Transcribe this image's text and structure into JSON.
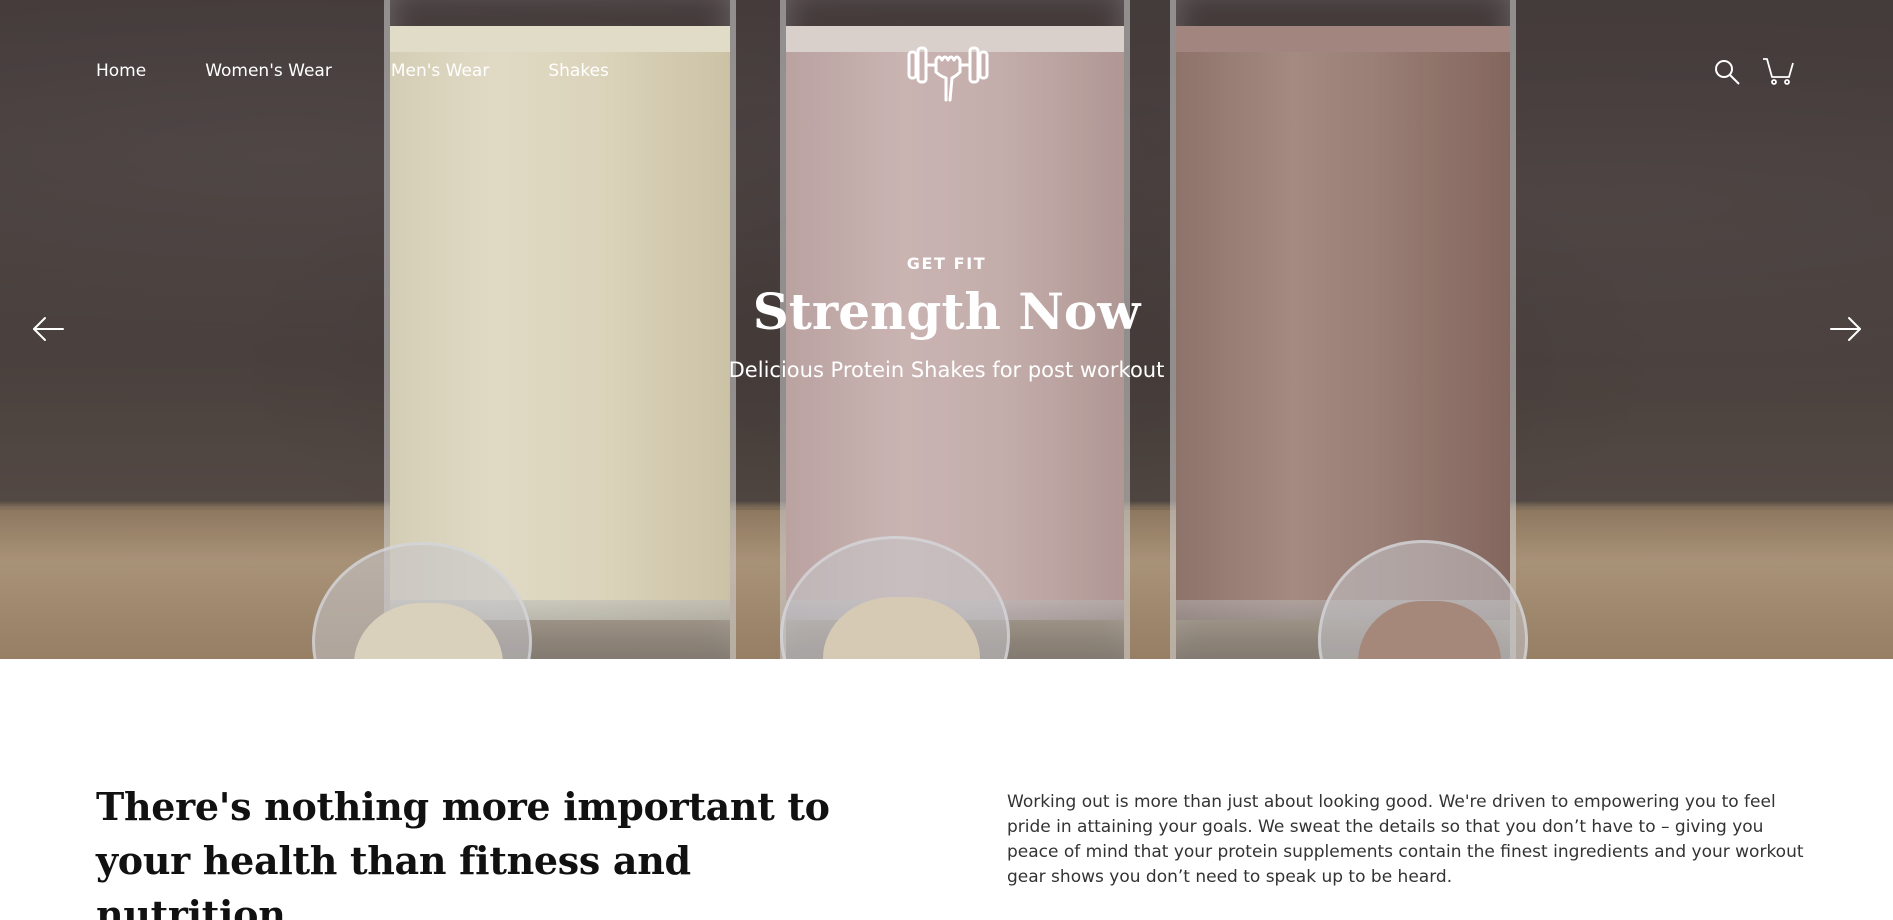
{
  "nav": {
    "items": [
      {
        "label": "Home"
      },
      {
        "label": "Women's Wear"
      },
      {
        "label": "Men's Wear"
      },
      {
        "label": "Shakes"
      }
    ]
  },
  "header": {
    "logo_icon": "flexed-arm-dumbbell-icon",
    "search_icon": "search-icon",
    "cart_icon": "cart-icon"
  },
  "hero": {
    "eyebrow": "GET FIT",
    "headline": "Strength Now",
    "subhead": "Delicious Protein Shakes for post workout",
    "prev_icon": "arrow-left-icon",
    "next_icon": "arrow-right-icon"
  },
  "intro": {
    "title": "There's nothing more important to your health than fitness and nutrition",
    "body": "Working out is more than just about looking good. We're driven to empowering you to feel pride in attaining your goals. We sweat the details so that you don’t have to – giving you peace of mind that your protein supplements contain the finest ingredients and your workout gear shows you don’t need to speak up to be heard."
  },
  "colors": {
    "hero_text": "#ffffff",
    "body_text": "#333333",
    "heading_text": "#111111"
  }
}
